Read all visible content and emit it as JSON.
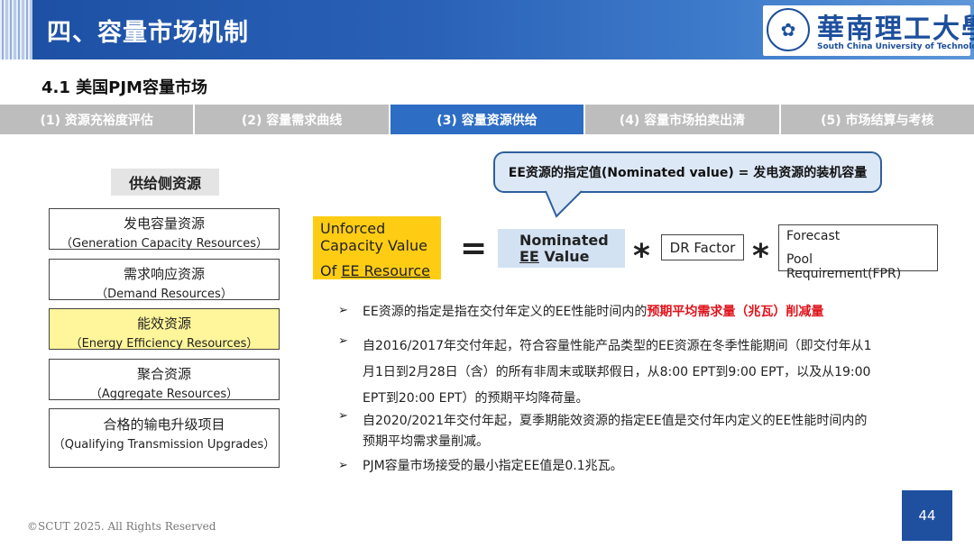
{
  "header": {
    "title": "四、容量市场机制"
  },
  "logo": {
    "seal_glyph": "✿",
    "name_zh": "華南理工大學",
    "name_en": "South China University of Technology"
  },
  "subtitle": "4.1 美国PJM容量市场",
  "tabs": [
    {
      "label": "(1) 资源充裕度评估",
      "active": false
    },
    {
      "label": "(2) 容量需求曲线",
      "active": false
    },
    {
      "label": "(3) 容量资源供给",
      "active": true
    },
    {
      "label": "(4) 容量市场拍卖出清",
      "active": false
    },
    {
      "label": "(5) 市场结算与考核",
      "active": false
    }
  ],
  "supply_side": {
    "title": "供给侧资源",
    "items": [
      {
        "zh": "发电容量资源",
        "en": "（Generation Capacity Resources）"
      },
      {
        "zh": "需求响应资源",
        "en": "（Demand Resources）"
      },
      {
        "zh": "能效资源",
        "en": "（Energy Efficiency Resources）"
      },
      {
        "zh": "聚合资源",
        "en": "（Aggregate Resources）"
      },
      {
        "zh": "合格的输电升级项目",
        "en": "（Qualifying Transmission Upgrades）"
      }
    ]
  },
  "callout": "EE资源的指定值(Nominated value) = 发电资源的装机容量",
  "formula": {
    "ucv_line1": "Unforced",
    "ucv_line2": "Capacity Value",
    "ucv_line3_prefix": "Of ",
    "ucv_line3_link": "EE Resource",
    "equals": "=",
    "nominated_line1": "Nominated",
    "nominated_ee": "EE",
    "nominated_value": " Value",
    "star": "*",
    "dr_factor": "DR Factor",
    "fpr_line1": "Forecast",
    "fpr_line2": "Pool Requirement(FPR)"
  },
  "bullets": {
    "marker": "➢",
    "b1_prefix": "EE资源的指定是指在交付年定义的EE性能时间内的",
    "b1_highlight": "预期平均需求量（兆瓦）削减量",
    "b2_line1": "自2016/2017年交付年起，符合容量性能产品类型的EE资源在冬季性能期间（即交付年从1",
    "b2_line2": "月1日到2月28日（含）的所有非周末或联邦假日，从8:00 EPT到9:00 EPT，以及从19:00",
    "b2_line3": "EPT到20:00 EPT）的预期平均降荷量。",
    "b3_line1": "自2020/2021年交付年起，夏季期能效资源的指定EE值是交付年内定义的EE性能时间内的",
    "b3_line2": "预期平均需求量削减。",
    "b4": "PJM容量市场接受的最小指定EE值是0.1兆瓦。"
  },
  "page_number": "44",
  "copyright": "©SCUT 2025. All Rights Reserved"
}
